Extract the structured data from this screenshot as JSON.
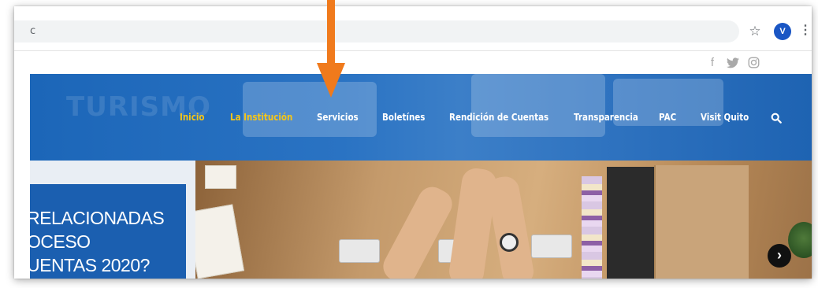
{
  "browser": {
    "address_text": "c",
    "avatar_letter": "V",
    "star_glyph": "☆",
    "menu_glyph": "⋮"
  },
  "social": {
    "facebook": "f",
    "twitter": "🐦",
    "instagram": "◎"
  },
  "brand": {
    "watermark": "TURISMO"
  },
  "nav": {
    "items": [
      {
        "label": "Inicio",
        "highlight": true
      },
      {
        "label": "La Institución",
        "highlight": true
      },
      {
        "label": "Servicios",
        "highlight": false
      },
      {
        "label": "Boletínes",
        "highlight": false
      },
      {
        "label": "Rendición de Cuentas",
        "highlight": false
      },
      {
        "label": "Transparencia",
        "highlight": false
      },
      {
        "label": "PAC",
        "highlight": false
      },
      {
        "label": "Visit Quito",
        "highlight": false
      }
    ],
    "highlight_color": "#f5c518",
    "bar_color": "#2a73c3"
  },
  "hero": {
    "lines": [
      "RELACIONADAS",
      "OCESO",
      "UENTAS 2020?"
    ],
    "next_glyph": "›"
  },
  "annotation": {
    "arrow_color": "#f07a1c"
  }
}
